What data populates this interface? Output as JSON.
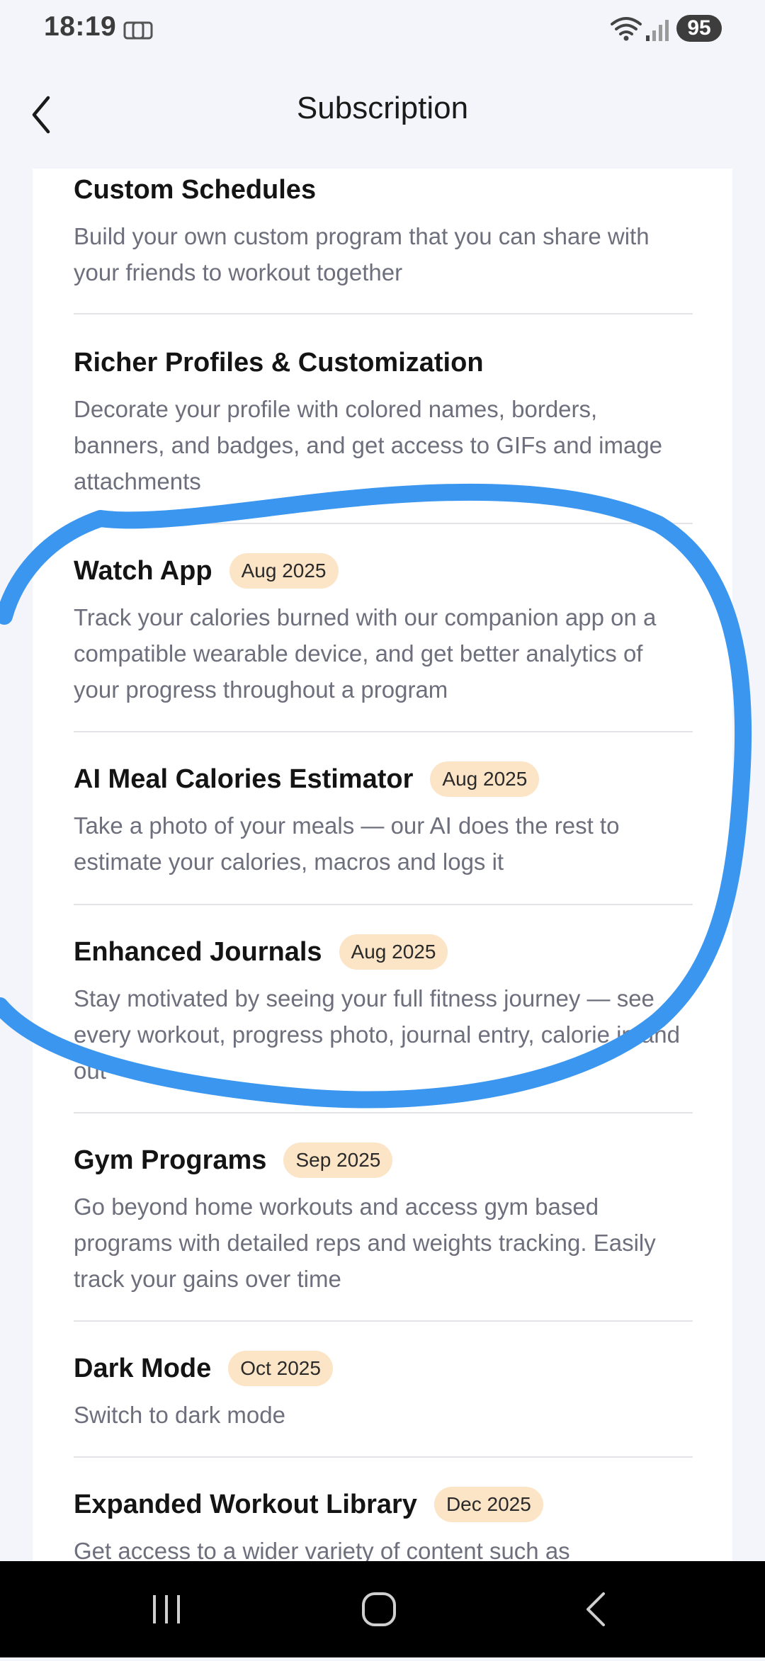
{
  "status_bar": {
    "time": "18:19",
    "battery": "95"
  },
  "header": {
    "title": "Subscription"
  },
  "features": [
    {
      "title": "Custom Schedules",
      "badge": "",
      "description": "Build your own custom program that you can share with your friends to workout together"
    },
    {
      "title": "Richer Profiles & Customization",
      "badge": "",
      "description": "Decorate your profile with colored names, borders, banners, and badges, and get access to GIFs and image attachments"
    },
    {
      "title": "Watch App",
      "badge": "Aug 2025",
      "description": "Track your calories burned with our companion app on a compatible wearable device, and get better analytics of your progress throughout a program"
    },
    {
      "title": "AI Meal Calories Estimator",
      "badge": "Aug 2025",
      "description": "Take a photo of your meals — our AI does the rest to estimate your calories, macros and logs it"
    },
    {
      "title": "Enhanced Journals",
      "badge": "Aug 2025",
      "description": "Stay motivated by seeing your full fitness journey — see every workout, progress photo, journal entry, calorie in and out"
    },
    {
      "title": "Gym Programs",
      "badge": "Sep 2025",
      "description": "Go beyond home workouts and access gym based programs with detailed reps and weights tracking. Easily track your gains over time"
    },
    {
      "title": "Dark Mode",
      "badge": "Oct 2025",
      "description": "Switch to dark mode"
    },
    {
      "title": "Expanded Workout Library",
      "badge": "Dec 2025",
      "description": "Get access to a wider variety of content such as"
    }
  ],
  "colors": {
    "annotation": "#3b96f0",
    "badge_bg": "#fce4c6",
    "card_bg": "#ffffff",
    "page_bg": "#f4f5fa"
  },
  "icons": {
    "status_left": "screen-mirror-icon",
    "wifi": "wifi-icon",
    "signal": "signal-icon",
    "back": "chevron-left-icon",
    "nav_recents": "recents-icon",
    "nav_home": "home-icon",
    "nav_back": "back-icon"
  }
}
